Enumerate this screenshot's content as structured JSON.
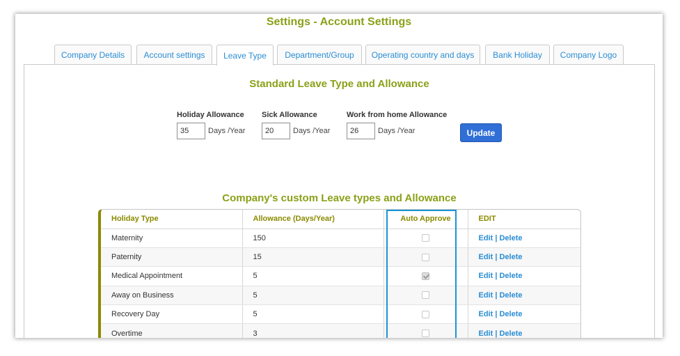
{
  "page_title": "Settings - Account Settings",
  "tabs": [
    {
      "label": "Company Details"
    },
    {
      "label": "Account settings"
    },
    {
      "label": "Leave Type"
    },
    {
      "label": "Department/Group"
    },
    {
      "label": "Operating country and days"
    },
    {
      "label": "Bank Holiday"
    },
    {
      "label": "Company Logo"
    }
  ],
  "active_tab": "Leave Type",
  "standard": {
    "title": "Standard Leave Type and Allowance",
    "holiday": {
      "label": "Holiday Allowance",
      "value": "35",
      "unit": "Days /Year"
    },
    "sick": {
      "label": "Sick Allowance",
      "value": "20",
      "unit": "Days /Year"
    },
    "wfh": {
      "label": "Work from home Allowance",
      "value": "26",
      "unit": "Days /Year"
    },
    "update_label": "Update"
  },
  "custom": {
    "title": "Company's custom Leave types and Allowance",
    "headers": [
      "Holiday Type",
      "Allowance (Days/Year)",
      "Auto Approve",
      "EDIT"
    ],
    "edit_label": "Edit",
    "separator": "|",
    "delete_label": "Delete",
    "rows": [
      {
        "type": "Maternity",
        "allowance": "150",
        "auto_approve": false
      },
      {
        "type": "Paternity",
        "allowance": "15",
        "auto_approve": false
      },
      {
        "type": "Medical Appointment",
        "allowance": "5",
        "auto_approve": true
      },
      {
        "type": "Away on Business",
        "allowance": "5",
        "auto_approve": false
      },
      {
        "type": "Recovery Day",
        "allowance": "5",
        "auto_approve": false
      },
      {
        "type": "Overtime",
        "allowance": "3",
        "auto_approve": false
      }
    ]
  },
  "colors": {
    "accent_green": "#8aa118",
    "link_blue": "#2a8dd4",
    "button_blue": "#2f6fd6",
    "highlight_blue": "#1a94d6"
  }
}
